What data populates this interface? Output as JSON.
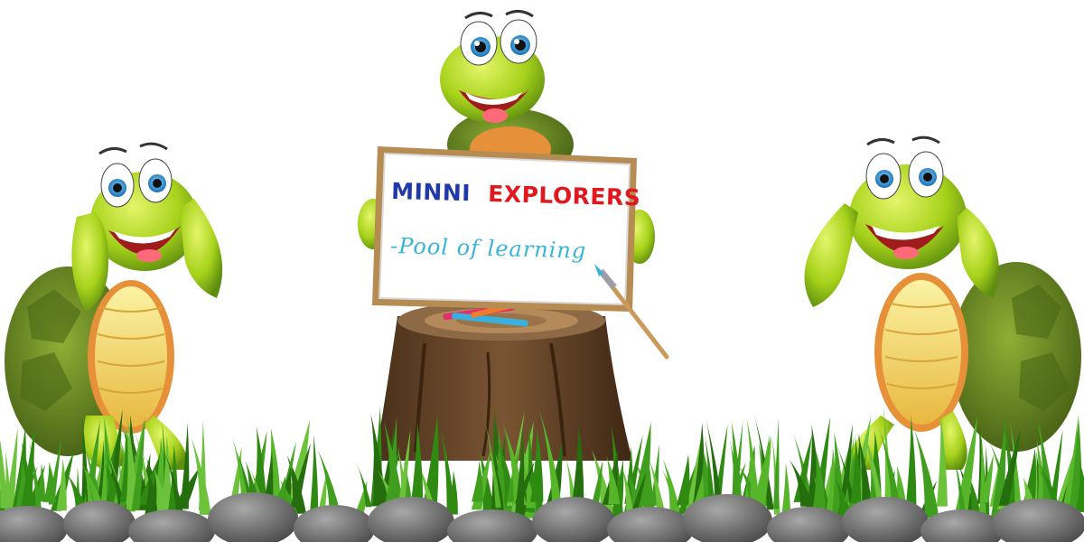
{
  "sign": {
    "title_part1": "MINNI",
    "title_part2": "EXPLORERS",
    "subtitle": "-Pool of learning"
  },
  "colors": {
    "title_blue": "#1f3aa8",
    "title_red": "#e0191f",
    "subtitle_cyan": "#38b4d8",
    "grass": "#3f9e1d",
    "turtle_skin": "#a7d21b",
    "turtle_shell": "#5b7f1e",
    "turtle_belly": "#f3e36e",
    "stump": "#6b4a2b",
    "board_frame": "#b78c52",
    "rocks": "#7a7a7a"
  },
  "icons": [
    "turtle-left",
    "turtle-center",
    "turtle-right",
    "whiteboard",
    "paintbrush",
    "crayons",
    "tree-stump",
    "grass",
    "rocks"
  ]
}
